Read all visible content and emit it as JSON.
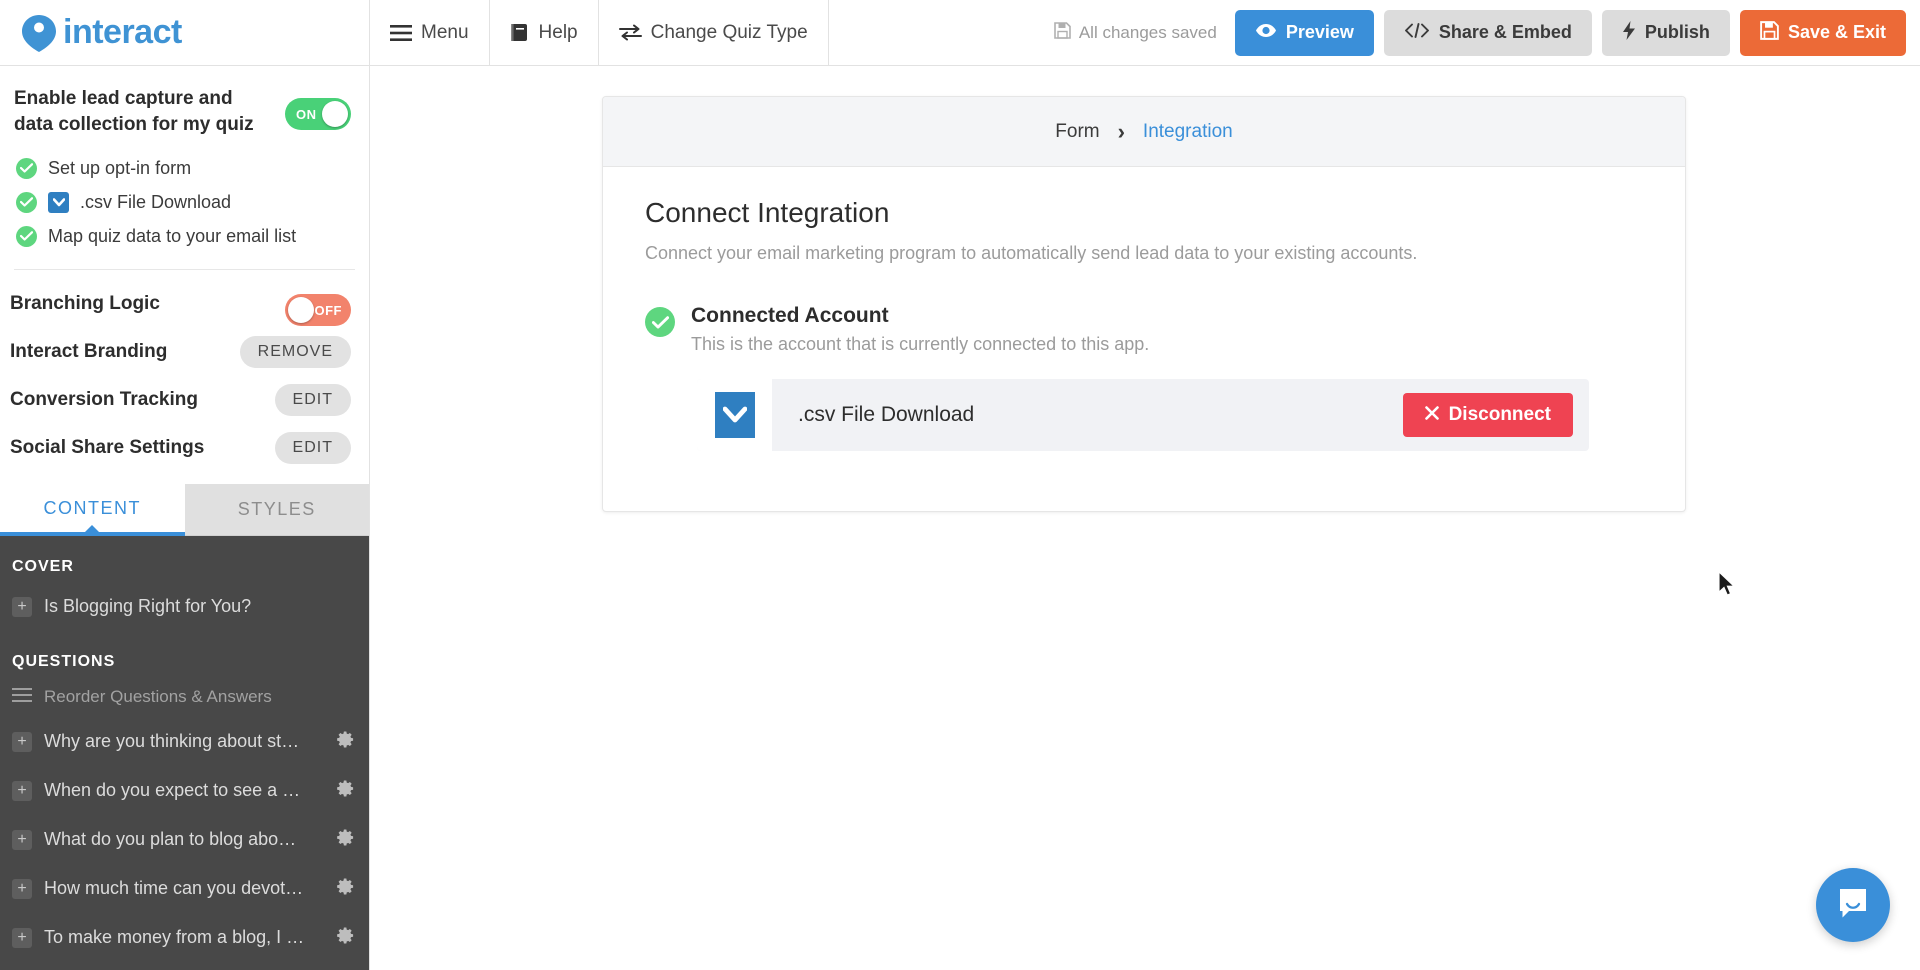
{
  "brand": {
    "name": "interact",
    "color": "#3f93d4"
  },
  "topbar": {
    "menu": [
      {
        "label": "Menu",
        "icon": "hamburger-icon"
      },
      {
        "label": "Help",
        "icon": "book-icon"
      },
      {
        "label": "Change Quiz Type",
        "icon": "swap-icon"
      }
    ],
    "status": {
      "text": "All changes saved",
      "icon": "save-icon"
    },
    "actions": [
      {
        "label": "Preview",
        "icon": "eye-icon",
        "style": "blue"
      },
      {
        "label": "Share & Embed",
        "icon": "code-icon",
        "style": "gray"
      },
      {
        "label": "Publish",
        "icon": "bolt-icon",
        "style": "gray"
      },
      {
        "label": "Save & Exit",
        "icon": "save-icon",
        "style": "orange"
      }
    ]
  },
  "sidebar": {
    "lead_capture": {
      "title": "Enable lead capture and data collection for my quiz",
      "toggle_state": "ON"
    },
    "checklist": [
      {
        "label": "Set up opt-in form",
        "icon": null
      },
      {
        "label": ".csv File Download",
        "icon": "csv-download-icon"
      },
      {
        "label": "Map quiz data to your email list",
        "icon": null
      }
    ],
    "settings": [
      {
        "label": "Branching Logic",
        "control": "toggle",
        "value": "OFF"
      },
      {
        "label": "Interact Branding",
        "control": "button",
        "value": "REMOVE"
      },
      {
        "label": "Conversion Tracking",
        "control": "button",
        "value": "EDIT"
      },
      {
        "label": "Social Share Settings",
        "control": "button",
        "value": "EDIT"
      }
    ],
    "tabs": [
      {
        "label": "CONTENT",
        "active": true
      },
      {
        "label": "STYLES",
        "active": false
      }
    ],
    "cover": {
      "heading": "COVER",
      "items": [
        {
          "label": "Is Blogging Right for You?"
        }
      ]
    },
    "questions": {
      "heading": "QUESTIONS",
      "reorder_label": "Reorder Questions & Answers",
      "items": [
        {
          "label": "Why are you thinking about st…"
        },
        {
          "label": "When do you expect to see a …"
        },
        {
          "label": "What do you plan to blog abo…"
        },
        {
          "label": "How much time can you devot…"
        },
        {
          "label": "To make money from a blog, I …"
        }
      ]
    }
  },
  "main": {
    "breadcrumb": [
      {
        "label": "Form",
        "active": false
      },
      {
        "label": "Integration",
        "active": true
      }
    ],
    "breadcrumb_separator": "›",
    "title": "Connect Integration",
    "subtitle": "Connect your email marketing program to automatically send lead data to your existing accounts.",
    "connected_account": {
      "title": "Connected Account",
      "subtitle": "This is the account that is currently connected to this app.",
      "account_name": ".csv File Download",
      "disconnect_label": "Disconnect",
      "disconnect_color": "#ef4352"
    }
  },
  "chat": {
    "icon": "chat-bubble-icon",
    "color": "#3a8fd9"
  }
}
